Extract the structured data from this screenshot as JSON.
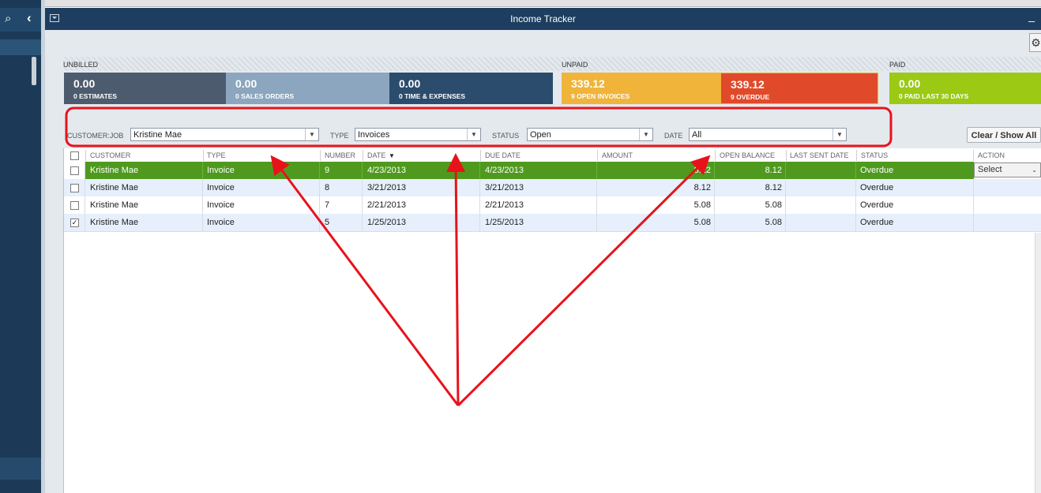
{
  "window": {
    "title": "Income Tracker"
  },
  "colors": {
    "estimates": "#4d5b6e",
    "sales_orders": "#8ba6be",
    "time_expenses": "#2b4c6d",
    "open_invoices": "#f0b43a",
    "overdue": "#e04a2a",
    "paid": "#9bc914",
    "selected_row": "#4f9a1e",
    "annotation": "#e8121b"
  },
  "sections": {
    "unbilled": "UNBILLED",
    "unpaid": "UNPAID",
    "paid": "PAID"
  },
  "tiles": [
    {
      "amount": "0.00",
      "label": "0 ESTIMATES"
    },
    {
      "amount": "0.00",
      "label": "0 SALES ORDERS"
    },
    {
      "amount": "0.00",
      "label": "0 TIME & EXPENSES"
    },
    {
      "amount": "339.12",
      "label": "9 OPEN INVOICES"
    },
    {
      "amount": "339.12",
      "label": "9 OVERDUE"
    },
    {
      "amount": "0.00",
      "label": "0 PAID LAST 30 DAYS"
    }
  ],
  "filters": {
    "customer_label": "CUSTOMER:JOB",
    "customer_value": "Kristine Mae",
    "type_label": "TYPE",
    "type_value": "Invoices",
    "status_label": "STATUS",
    "status_value": "Open",
    "date_label": "DATE",
    "date_value": "All",
    "clear_label": "Clear / Show All"
  },
  "table": {
    "columns": [
      "CUSTOMER",
      "TYPE",
      "NUMBER",
      "DATE",
      "DUE DATE",
      "AMOUNT",
      "OPEN BALANCE",
      "LAST SENT DATE",
      "STATUS",
      "ACTION"
    ],
    "sort_indicator": "▼",
    "action_select_label": "Select",
    "rows": [
      {
        "checked": "",
        "customer": "Kristine Mae",
        "type": "Invoice",
        "number": "9",
        "date": "4/23/2013",
        "due": "4/23/2013",
        "amount": "8.12",
        "balance": "8.12",
        "last_sent": "",
        "status": "Overdue"
      },
      {
        "checked": "",
        "customer": "Kristine Mae",
        "type": "Invoice",
        "number": "8",
        "date": "3/21/2013",
        "due": "3/21/2013",
        "amount": "8.12",
        "balance": "8.12",
        "last_sent": "",
        "status": "Overdue"
      },
      {
        "checked": "",
        "customer": "Kristine Mae",
        "type": "Invoice",
        "number": "7",
        "date": "2/21/2013",
        "due": "2/21/2013",
        "amount": "5.08",
        "balance": "5.08",
        "last_sent": "",
        "status": "Overdue"
      },
      {
        "checked": "✓",
        "customer": "Kristine Mae",
        "type": "Invoice",
        "number": "5",
        "date": "1/25/2013",
        "due": "1/25/2013",
        "amount": "5.08",
        "balance": "5.08",
        "last_sent": "",
        "status": "Overdue"
      }
    ]
  },
  "icons": {
    "search": "⌕",
    "collapse": "‹",
    "gear": "⚙",
    "minimize": "_",
    "dropdown": "▼",
    "select_chevron": "⌄"
  }
}
